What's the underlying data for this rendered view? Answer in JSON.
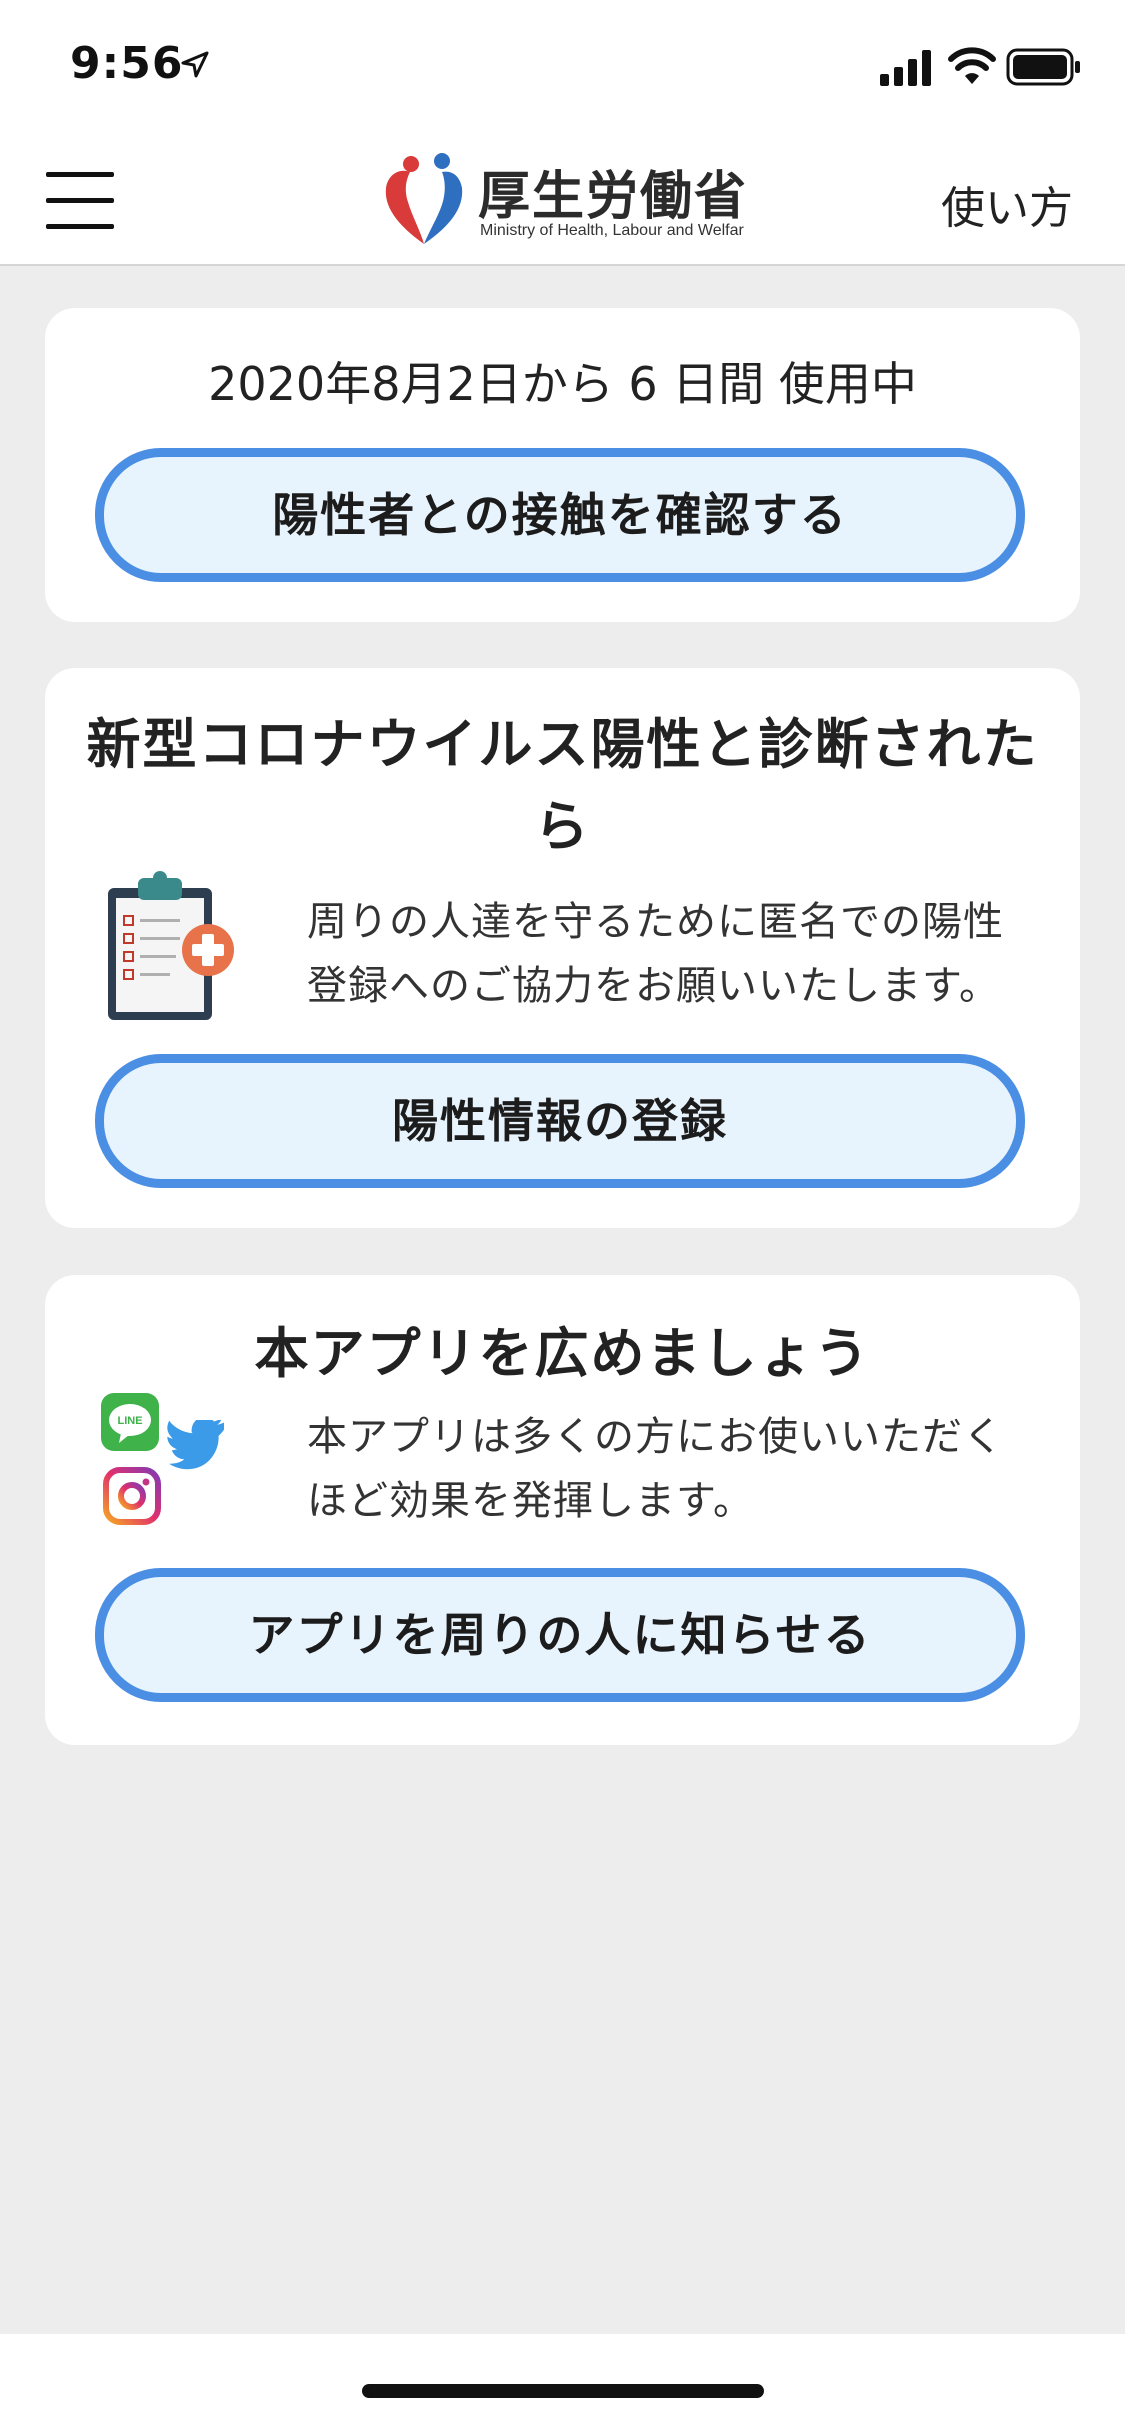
{
  "status_bar": {
    "time": "9:56",
    "icons": [
      "location-arrow-icon",
      "cellular-signal-icon",
      "wifi-icon",
      "battery-icon"
    ]
  },
  "header": {
    "menu_icon": "hamburger-menu-icon",
    "logo_title": "厚生労働省",
    "logo_subtitle": "Ministry of Health, Labour and Welfar",
    "howto_label": "使い方",
    "logo_colors": {
      "red": "#d93a3a",
      "blue": "#2f6fc0"
    }
  },
  "card_contact": {
    "usage_text": "2020年8月2日から 6 日間 使用中",
    "button_label": "陽性者との接触を確認する"
  },
  "card_positive": {
    "heading": "新型コロナウイルス陽性と診断されたら",
    "description": "周りの人達を守るために匿名での陽性登録へのご協力をお願いいたします。",
    "icon": "clipboard-medical-icon",
    "button_label": "陽性情報の登録"
  },
  "card_share": {
    "heading": "本アプリを広めましょう",
    "description": "本アプリは多くの方にお使いいただくほど効果を発揮します。",
    "icons": [
      "line-icon",
      "twitter-icon",
      "instagram-icon"
    ],
    "line_label": "LINE",
    "button_label": "アプリを周りの人に知らせる"
  },
  "colors": {
    "button_border": "#4a8fe3",
    "button_fill": "#e8f4fd",
    "page_background": "#ededed",
    "line_green": "#3fb24a",
    "twitter_blue": "#3b9be8"
  }
}
